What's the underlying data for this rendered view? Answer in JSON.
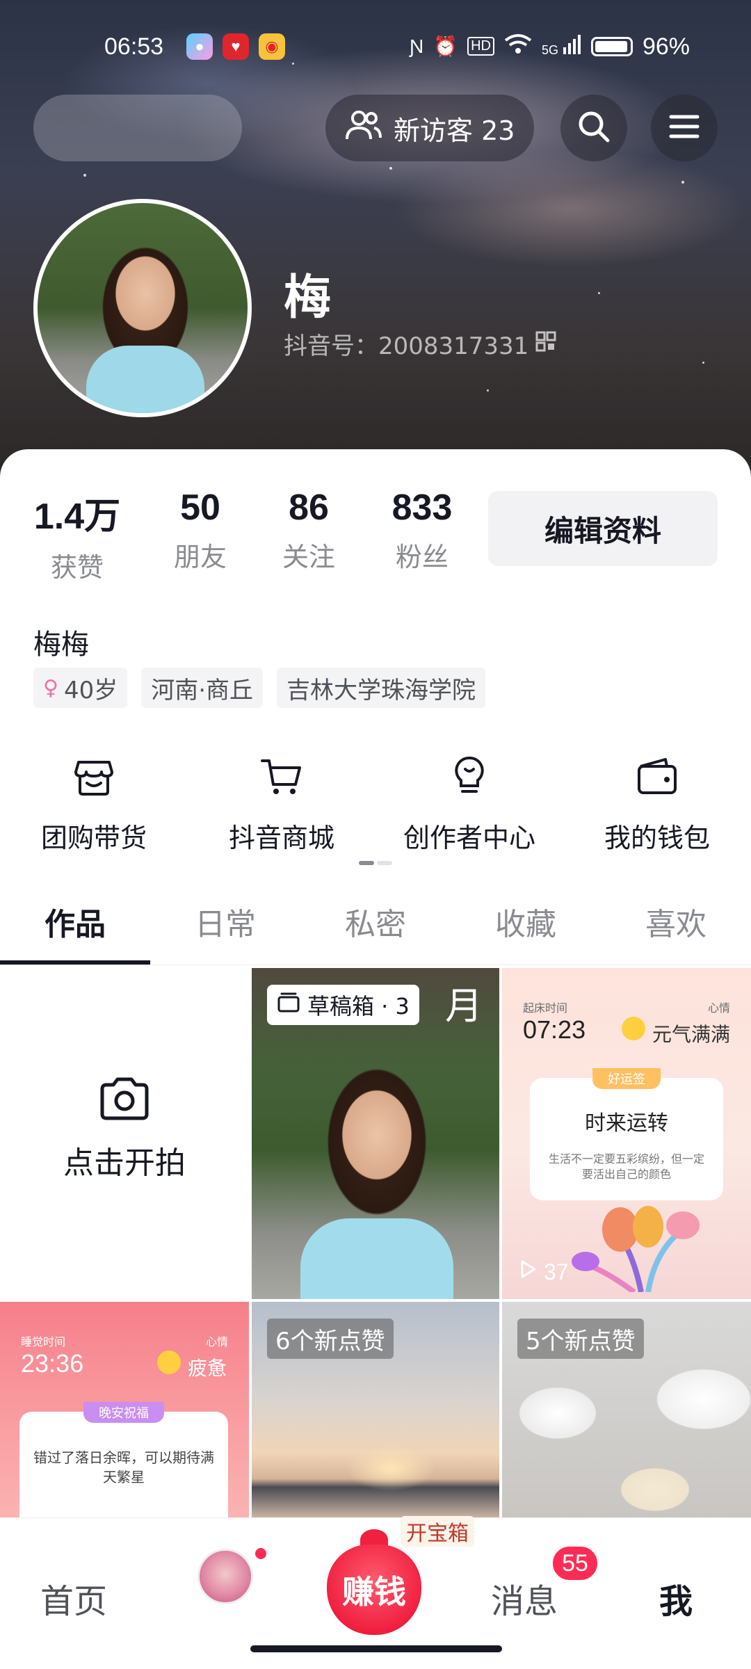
{
  "status_bar": {
    "time": "06:53",
    "network": "5G",
    "battery": "96%"
  },
  "header": {
    "visitors_label": "新访客 23"
  },
  "profile": {
    "name": "梅",
    "douyin_id": "抖音号：2008317331",
    "nickname": "梅梅",
    "tags": [
      {
        "label": "40岁",
        "icon": "female-icon"
      },
      {
        "label": "河南·商丘"
      },
      {
        "label": "吉林大学珠海学院"
      }
    ]
  },
  "stats": [
    {
      "value": "1.4万",
      "label": "获赞"
    },
    {
      "value": "50",
      "label": "朋友"
    },
    {
      "value": "86",
      "label": "关注"
    },
    {
      "value": "833",
      "label": "粉丝"
    }
  ],
  "edit_button": "编辑资料",
  "services": [
    {
      "label": "团购带货",
      "icon": "shop-icon"
    },
    {
      "label": "抖音商城",
      "icon": "cart-icon"
    },
    {
      "label": "创作者中心",
      "icon": "lightbulb-icon"
    },
    {
      "label": "我的钱包",
      "icon": "wallet-icon"
    }
  ],
  "tabs": [
    "作品",
    "日常",
    "私密",
    "收藏",
    "喜欢"
  ],
  "grid": {
    "shoot_label": "点击开拍",
    "draft": {
      "label": "草稿箱 · 3",
      "corner_char": "月"
    },
    "mood1": {
      "time_caption": "起床时间",
      "time": "07:23",
      "mood_caption": "心情",
      "mood": "元气满满",
      "pill": "好运签",
      "headline": "时来运转",
      "body": "生活不一定要五彩缤纷，但一定要活出自己的颜色",
      "views": "37"
    },
    "mood2": {
      "time_caption": "睡觉时间",
      "time": "23:36",
      "mood_caption": "心情",
      "mood": "疲惫",
      "pill": "晚安祝福",
      "body": "错过了落日余晖，可以期待满天繁星"
    },
    "sunset_badge": "6个新点赞",
    "food_badge": "5个新点赞"
  },
  "bottom_nav": {
    "home": "首页",
    "earn": "赚钱",
    "treasure": "开宝箱",
    "messages": "消息",
    "messages_badge": "55",
    "me": "我"
  },
  "colors": {
    "accent": "#fe2c55",
    "text": "#161823",
    "muted": "#8a8b91"
  }
}
